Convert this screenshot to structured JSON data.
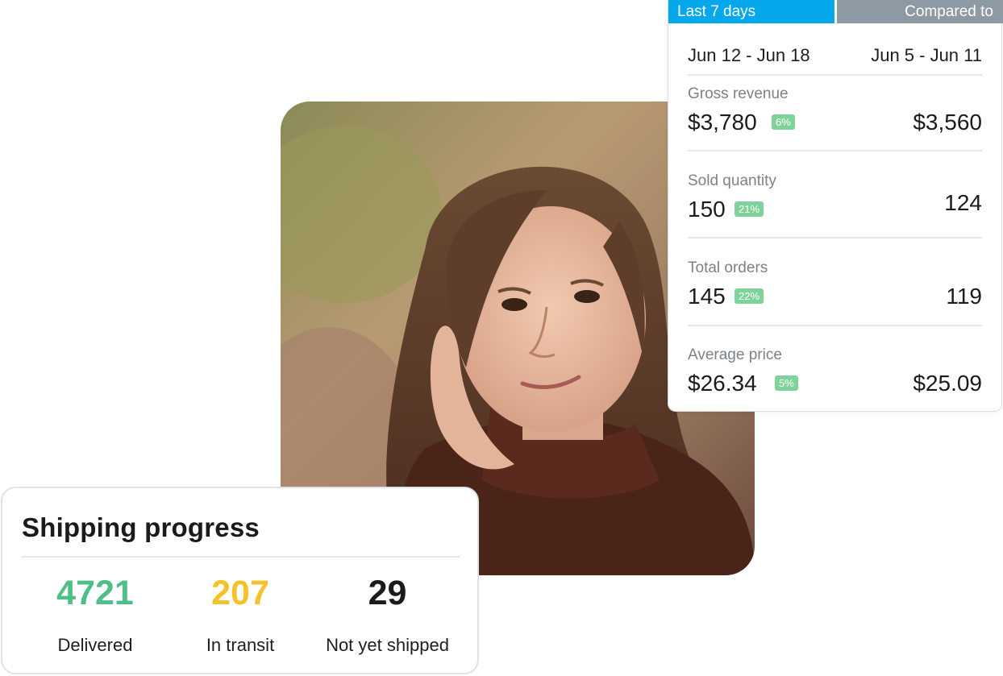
{
  "colors": {
    "tab_active": "#06a8ec",
    "tab_compare": "#8e9aa3",
    "badge_green": "#7ed29a",
    "delivered": "#4fbf88",
    "in_transit": "#f5c22b",
    "not_shipped": "#1b1b1b"
  },
  "stats": {
    "tab_active_label": "Last 7 days",
    "tab_compare_label": "Compared to",
    "current_range": "Jun 12 - Jun 18",
    "previous_range": "Jun 5 - Jun 11",
    "metrics": [
      {
        "label": "Gross revenue",
        "value": "$3,780",
        "change": "6%",
        "previous": "$3,560"
      },
      {
        "label": "Sold quantity",
        "value": "150",
        "change": "21%",
        "previous": "124"
      },
      {
        "label": "Total orders",
        "value": "145",
        "change": "22%",
        "previous": "119"
      },
      {
        "label": "Average price",
        "value": "$26.34",
        "change": "5%",
        "previous": "$25.09"
      }
    ]
  },
  "shipping": {
    "title": "Shipping progress",
    "items": [
      {
        "count": "4721",
        "label": "Delivered"
      },
      {
        "count": "207",
        "label": "In transit"
      },
      {
        "count": "29",
        "label": "Not yet shipped"
      }
    ]
  }
}
